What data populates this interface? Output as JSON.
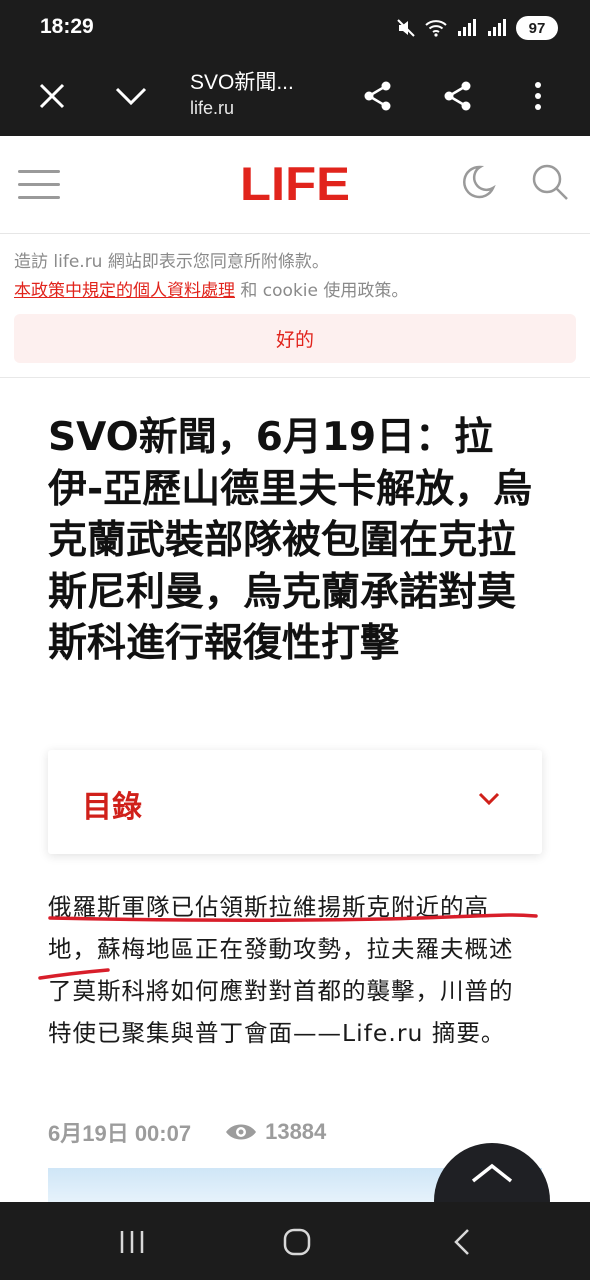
{
  "status_bar": {
    "time": "18:29",
    "battery": "97",
    "icons": [
      "mute-icon",
      "wifi-icon",
      "signal-icon",
      "signal-icon-2",
      "battery-icon"
    ]
  },
  "toolbar": {
    "title": "SVO新聞...",
    "url": "life.ru",
    "icons": [
      "close-icon",
      "chevron-down-icon",
      "share-icon",
      "share-icon",
      "more-vert-icon"
    ]
  },
  "site_header": {
    "logo": "LIFE",
    "brand_color": "#e1241c",
    "icons": [
      "menu-icon",
      "moon-icon",
      "search-icon"
    ]
  },
  "cookie_notice": {
    "text_before": "造訪 life.ru 網站即表示您同意所附條款。",
    "link_text": "本政策中規定的個人資料處理",
    "text_after": " 和 cookie 使用政策。",
    "ok_label": "好的"
  },
  "article": {
    "headline": "SVO新聞，6月19日：拉伊-亞歷山德里夫卡解放，烏克蘭武裝部隊被包圍在克拉斯尼利曼，烏克蘭承諾對莫斯科進行報復性打擊",
    "toc_label": "目錄",
    "lead": "俄羅斯軍隊已佔領斯拉維揚斯克附近的高地，蘇梅地區正在發動攻勢，拉夫羅夫概述了莫斯科將如何應對對首都的襲擊，川普的特使已聚集與普丁會面——Life.ru 摘要。",
    "date": "6月19日 00:07",
    "views": "13884"
  }
}
